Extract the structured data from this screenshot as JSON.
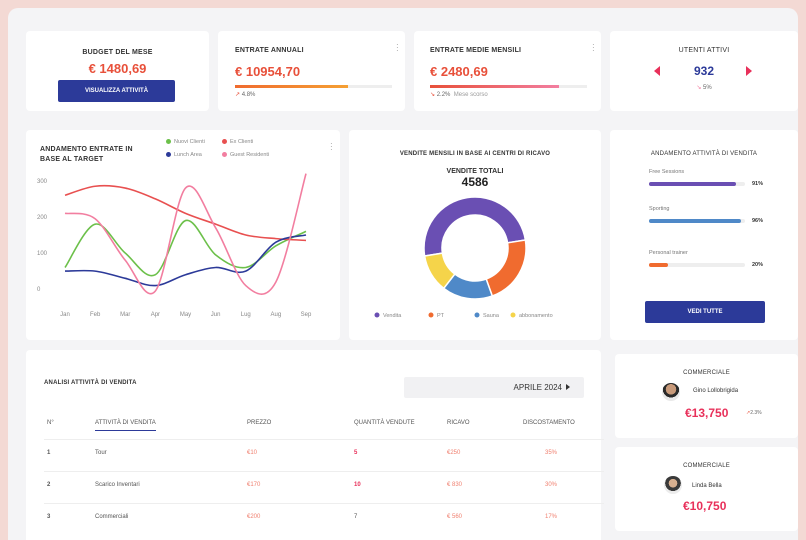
{
  "colors": {
    "accent": "#e8503a",
    "primary": "#2c3a99",
    "violet": "#6a4fb3",
    "blue": "#4f89c8",
    "orange": "#f06b2f",
    "yellow": "#f5d44a",
    "green": "#6cc04a",
    "pink": "#f27ea0",
    "red": "#e85050"
  },
  "budget": {
    "title": "BUDGET DEL MESE",
    "value": "€ 1480,69",
    "button": "VISUALIZZA ATTIVITÀ"
  },
  "entrate_annuali": {
    "title": "ENTRATE ANNUALI",
    "value": "€ 10954,70",
    "delta": "4.8%",
    "progress": 0.72
  },
  "entrate_mensili": {
    "title": "ENTRATE MEDIE MENSILI",
    "value": "€ 2480,69",
    "delta": "2.2%",
    "delta_note": "Mese scorso",
    "progress": 0.82
  },
  "utenti": {
    "title": "UTENTI ATTIVI",
    "value": "932",
    "delta": "5%"
  },
  "line_chart": {
    "title": "ANDAMENTO ENTRATE IN BASE AL TARGET",
    "legend": [
      {
        "name": "Nuovi Clienti",
        "color": "#6cc04a"
      },
      {
        "name": "Ex Clienti",
        "color": "#e85050"
      },
      {
        "name": "Lunch Area",
        "color": "#2c3a99"
      },
      {
        "name": "Guest Residenti",
        "color": "#f27ea0"
      }
    ]
  },
  "chart_data": [
    {
      "type": "line",
      "title": "ANDAMENTO ENTRATE IN BASE AL TARGET",
      "categories": [
        "Jan",
        "Feb",
        "Mar",
        "Apr",
        "May",
        "Jun",
        "Lug",
        "Aug",
        "Sep"
      ],
      "yticks": [
        0,
        100,
        200,
        300
      ],
      "ylim": [
        -30,
        330
      ],
      "series": [
        {
          "name": "Nuovi Clienti",
          "color": "#6cc04a",
          "values": [
            60,
            180,
            100,
            40,
            190,
            95,
            60,
            120,
            160
          ]
        },
        {
          "name": "Ex Clienti",
          "color": "#e85050",
          "values": [
            260,
            285,
            280,
            250,
            210,
            180,
            150,
            140,
            135
          ]
        },
        {
          "name": "Lunch Area",
          "color": "#2c3a99",
          "values": [
            50,
            50,
            30,
            10,
            40,
            60,
            50,
            130,
            150
          ]
        },
        {
          "name": "Guest Residenti",
          "color": "#f27ea0",
          "values": [
            210,
            195,
            80,
            -5,
            280,
            170,
            10,
            20,
            320
          ]
        }
      ]
    },
    {
      "type": "pie",
      "title": "VENDITE MENSILI IN BASE AI CENTRI DI RICAVO",
      "center_label": "VENDITE TOTALI",
      "total": "4586",
      "slices": [
        {
          "name": "Vendita",
          "value": 50,
          "color": "#6a4fb3"
        },
        {
          "name": "PT",
          "value": 22,
          "color": "#f06b2f"
        },
        {
          "name": "Sauna",
          "value": 16,
          "color": "#4f89c8"
        },
        {
          "name": "abbonamento",
          "value": 12,
          "color": "#f5d44a"
        }
      ]
    },
    {
      "type": "bar",
      "title": "ANDAMENTO ATTIVITÀ DI VENDITA",
      "categories": [
        "Free Sessions",
        "Sporting",
        "Personal trainer"
      ],
      "values": [
        91,
        96,
        20
      ],
      "labels": [
        "91%",
        "96%",
        "20%"
      ],
      "colors": [
        "#6a4fb3",
        "#4f89c8",
        "#f06b2f"
      ]
    }
  ],
  "donut": {
    "title": "VENDITE MENSILI IN BASE AI CENTRI DI RICAVO",
    "center_label": "VENDITE TOTALI",
    "total": "4586"
  },
  "activity": {
    "title": "ANDAMENTO ATTIVITÀ DI VENDITA",
    "items": [
      {
        "label": "Free Sessions",
        "pct": "91%"
      },
      {
        "label": "Sporting",
        "pct": "96%"
      },
      {
        "label": "Personal trainer",
        "pct": "20%"
      }
    ],
    "button": "VEDI TUTTE"
  },
  "table": {
    "title": "ANALISI ATTIVITÀ DI VENDITA",
    "month": "APRILE 2024",
    "headers": [
      "N°",
      "ATTIVITÀ DI VENDITA",
      "PREZZO",
      "QUANTITÀ VENDUTE",
      "RICAVO",
      "DISCOSTAMENTO"
    ],
    "rows": [
      [
        "1",
        "Tour",
        "€10",
        "5",
        "€250",
        "35%"
      ],
      [
        "2",
        "Scarico Inventari",
        "€170",
        "10",
        "€ 830",
        "30%"
      ],
      [
        "3",
        "Commerciali",
        "€200",
        "7",
        "€ 560",
        "17%"
      ]
    ]
  },
  "sales1": {
    "title": "COMMERCIALE",
    "name": "Gino Lollobrigida",
    "value": "€13,750",
    "delta": "2.3%"
  },
  "sales2": {
    "title": "COMMERCIALE",
    "name": "Linda Bella",
    "value": "€10,750"
  }
}
